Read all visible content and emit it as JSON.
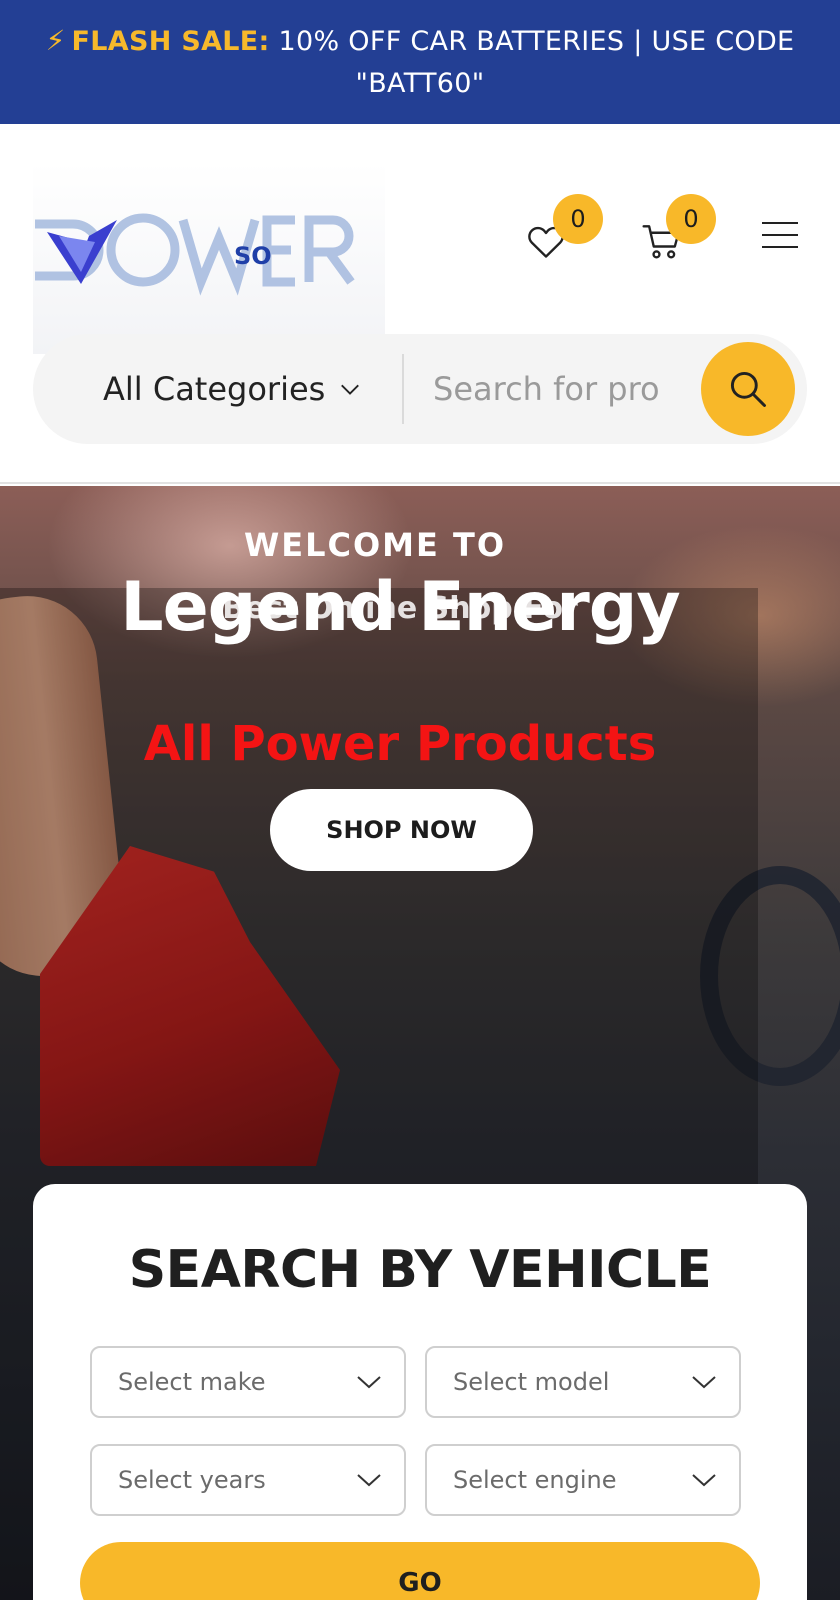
{
  "announcement": {
    "flash_label": "FLASH SALE:",
    "message": "10% OFF CAR BATTERIES | USE CODE \"BATT60\""
  },
  "header": {
    "logo_text": "POWER",
    "logo_sub": "SO",
    "wishlist_count": "0",
    "cart_count": "0"
  },
  "search": {
    "category_label": "All Categories",
    "placeholder": "Search for pro"
  },
  "hero": {
    "welcome": "WELCOME TO",
    "brand": "Legend Energy",
    "tagline": "Best Online Shop For",
    "products": "All Power Products",
    "cta": "SHOP NOW"
  },
  "vehicle_search": {
    "title": "SEARCH BY VEHICLE",
    "make": "Select make",
    "model": "Select model",
    "years": "Select years",
    "engine": "Select engine",
    "submit": "GO"
  },
  "colors": {
    "announcement_bg": "#233f94",
    "accent": "#f8b829",
    "products_red": "#f41414"
  },
  "icons": [
    "bolt-icon",
    "heart-icon",
    "cart-icon",
    "menu-icon",
    "chevron-down-icon",
    "search-icon"
  ]
}
